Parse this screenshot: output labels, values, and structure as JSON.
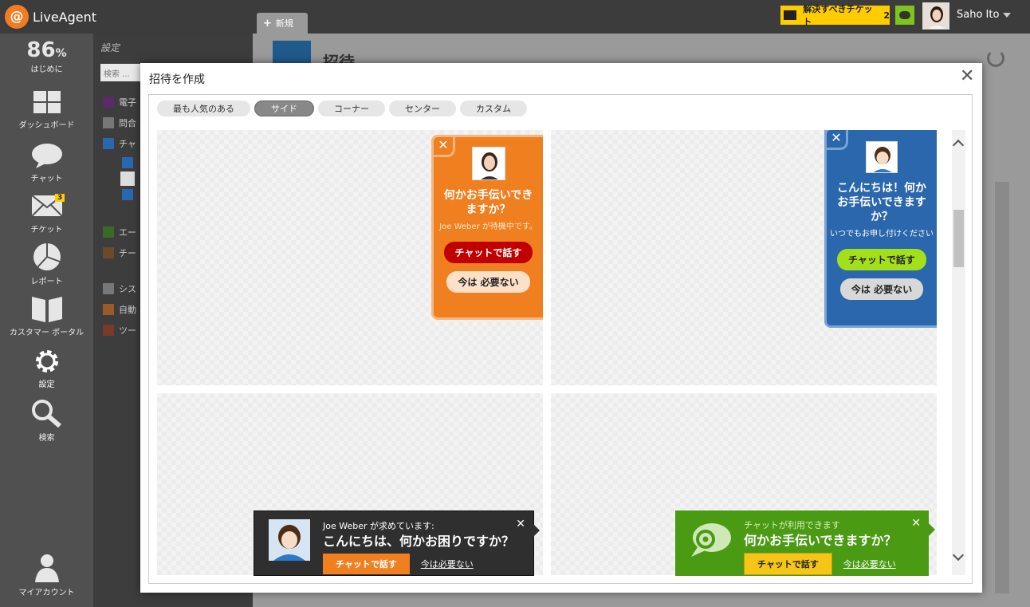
{
  "app": {
    "name": "LiveAgent",
    "logo_letter": "@"
  },
  "topbar": {
    "new_tab_label": "新規",
    "pending_label": "解決すべきチケット",
    "pending_count": "2",
    "user_name": "Saho Ito"
  },
  "leftnav": {
    "progress_value": "86",
    "progress_unit": "%",
    "items": [
      {
        "label": "はじめに"
      },
      {
        "label": "ダッシュボード"
      },
      {
        "label": "チャット"
      },
      {
        "label": "チケット",
        "badge": "3"
      },
      {
        "label": "レポート"
      },
      {
        "label": "カスタマー ポータル"
      },
      {
        "label": "設定"
      },
      {
        "label": "検索"
      },
      {
        "label": "マイアカウント"
      }
    ]
  },
  "subpanel": {
    "title": "設定",
    "search_placeholder": "検索 ...",
    "rows": [
      "電子",
      "問合",
      "チャ",
      "エー",
      "チー",
      "シス",
      "自動",
      "ツー"
    ]
  },
  "main": {
    "title": "招待"
  },
  "modal": {
    "title": "招待を作成",
    "tabs": [
      {
        "label": "最も人気のある",
        "active": false
      },
      {
        "label": "サイド",
        "active": true
      },
      {
        "label": "コーナー",
        "active": false
      },
      {
        "label": "センター",
        "active": false
      },
      {
        "label": "カスタム",
        "active": false
      }
    ],
    "invite_orange": {
      "heading": "何かお手伝いできますか？",
      "sub": "Joe Weber が待機中です。",
      "accept": "チャットで話す",
      "decline": "今は 必要ない"
    },
    "invite_blue": {
      "heading": "こんにちは！何かお手伝いできますか？",
      "sub": "いつでもお申し付けください",
      "accept": "チャットで話す",
      "decline": "今は 必要ない"
    },
    "bar_dark": {
      "small": "Joe Weber が求めています:",
      "big": "こんにちは、何かお困りですか？",
      "accept": "チャットで話す",
      "decline": "今は必要ない"
    },
    "bar_green": {
      "small": "チャットが利用できます",
      "big": "何かお手伝いできますか？",
      "accept": "チャットで話す",
      "decline": "今は必要ない"
    }
  },
  "colors": {
    "brand_orange": "#f47c20",
    "invite_orange": "#f07f1f",
    "invite_blue": "#2a67ad",
    "bar_green": "#4a9a14",
    "accept_red": "#c00000",
    "accept_lime": "#a4e01a"
  }
}
